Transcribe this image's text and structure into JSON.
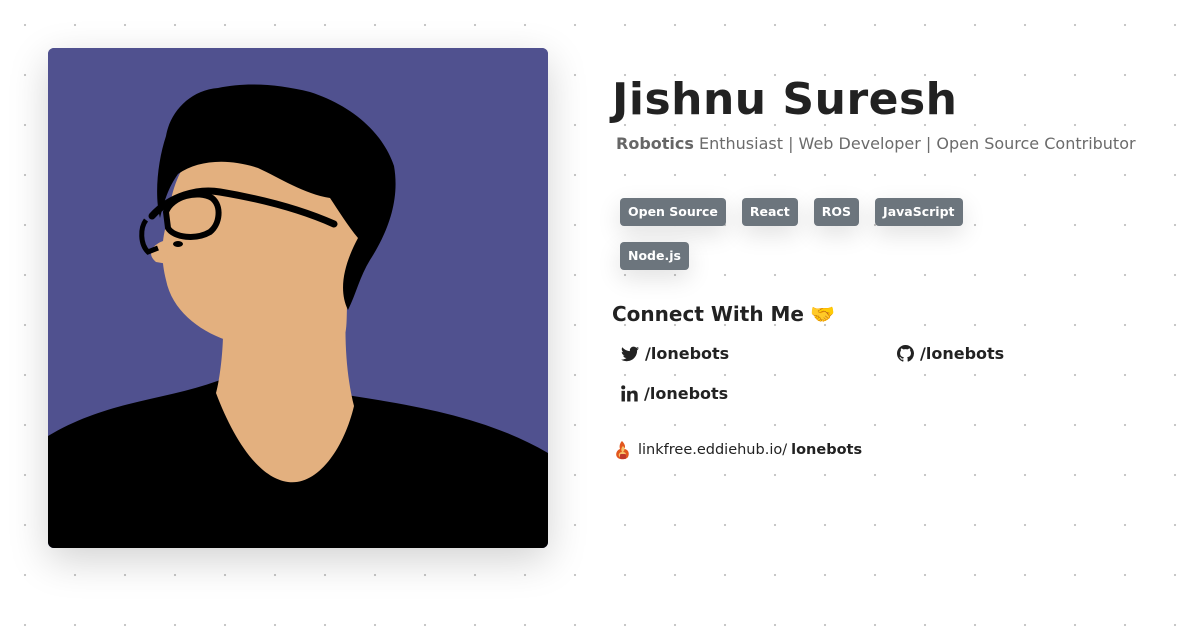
{
  "profile": {
    "name": "Jishnu Suresh",
    "tagline_strong": "Robotics",
    "tagline_rest": " Enthusiast | Web Developer | Open Source Contributor"
  },
  "tags": [
    "Open Source",
    "React",
    "ROS",
    "JavaScript",
    "Node.js"
  ],
  "connect": {
    "heading": "Connect With Me",
    "heading_icon": "handshake-emoji"
  },
  "socials": {
    "twitter": {
      "icon": "twitter-icon",
      "handle": "/lonebots"
    },
    "github": {
      "icon": "github-icon",
      "handle": "/lonebots"
    },
    "linkedin": {
      "icon": "linkedin-icon",
      "handle": "/lonebots"
    }
  },
  "linkfree": {
    "icon": "linkfree-logo",
    "prefix": "linkfree.eddiehub.io/",
    "username": "lonebots"
  },
  "colors": {
    "avatar_background": "#50518f",
    "skin": "#e3b07f",
    "tag_background": "#6c757d",
    "text_primary": "#222222",
    "text_muted": "#6b6b6b"
  }
}
